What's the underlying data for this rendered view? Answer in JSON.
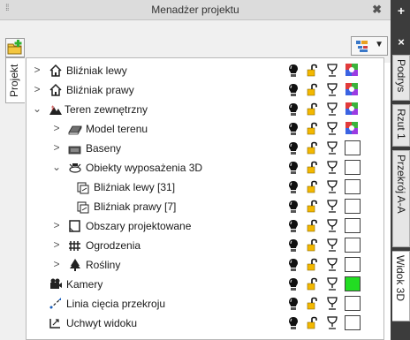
{
  "panel": {
    "title": "Menadżer projektu",
    "grip_symbol": "⁞⁞",
    "close_symbol": "✖"
  },
  "toolbar": {
    "add_icon": "add-folder-icon",
    "view_icon": "view-options-icon",
    "dropdown_symbol": "▼"
  },
  "left_tab": {
    "label": "Projekt"
  },
  "right_dock": {
    "plus_symbol": "+",
    "close_symbol": "×",
    "tabs": [
      {
        "label": "Podrys"
      },
      {
        "label": "Rzut 1"
      },
      {
        "label": "Przekrój A-A"
      },
      {
        "label": "Widok 3D"
      }
    ]
  },
  "tree": {
    "rows": [
      {
        "label": "Bliźniak lewy",
        "expander": ">",
        "icon": "house-icon",
        "visible": "bulb-icon",
        "lock": "unlock-icon",
        "render": "chalice-icon",
        "color_kind": "palette",
        "color_value": ""
      },
      {
        "label": "Bliźniak prawy",
        "expander": ">",
        "icon": "house-icon",
        "visible": "bulb-icon",
        "lock": "unlock-icon",
        "render": "chalice-icon",
        "color_kind": "palette",
        "color_value": ""
      },
      {
        "label": "Teren zewnętrzny",
        "expander": "⌄",
        "icon": "terrain-icon",
        "visible": "bulb-icon",
        "lock": "unlock-icon",
        "render": "chalice-icon",
        "color_kind": "palette",
        "color_value": ""
      },
      {
        "label": "Model terenu",
        "expander": ">",
        "icon": "terrain-model-icon",
        "visible": "bulb-icon",
        "lock": "unlock-icon",
        "render": "chalice-icon",
        "color_kind": "palette",
        "color_value": ""
      },
      {
        "label": "Baseny",
        "expander": ">",
        "icon": "pool-icon",
        "visible": "bulb-icon",
        "lock": "unlock-icon",
        "render": "chalice-icon",
        "color_kind": "box",
        "color_value": "#ffffff"
      },
      {
        "label": "Obiekty wyposażenia 3D",
        "expander": "⌄",
        "icon": "equipment-icon",
        "visible": "bulb-icon",
        "lock": "unlock-icon",
        "render": "chalice-icon",
        "color_kind": "box",
        "color_value": "#ffffff"
      },
      {
        "label": "Bliźniak lewy [31]",
        "expander": "",
        "icon": "object-copy-icon",
        "visible": "bulb-icon",
        "lock": "unlock-icon",
        "render": "chalice-icon",
        "color_kind": "box",
        "color_value": "#ffffff"
      },
      {
        "label": "Bliźniak prawy [7]",
        "expander": "",
        "icon": "object-copy-icon",
        "visible": "bulb-icon",
        "lock": "unlock-icon",
        "render": "chalice-icon",
        "color_kind": "box",
        "color_value": "#ffffff"
      },
      {
        "label": "Obszary projektowane",
        "expander": ">",
        "icon": "area-icon",
        "visible": "bulb-icon",
        "lock": "unlock-icon",
        "render": "chalice-icon",
        "color_kind": "box",
        "color_value": "#ffffff"
      },
      {
        "label": "Ogrodzenia",
        "expander": ">",
        "icon": "fence-icon",
        "visible": "bulb-icon",
        "lock": "unlock-icon",
        "render": "chalice-icon",
        "color_kind": "box",
        "color_value": "#ffffff"
      },
      {
        "label": "Rośliny",
        "expander": ">",
        "icon": "tree-icon",
        "visible": "bulb-icon",
        "lock": "unlock-icon",
        "render": "chalice-icon",
        "color_kind": "box",
        "color_value": "#ffffff"
      },
      {
        "label": "Kamery",
        "expander": "",
        "icon": "camera-icon",
        "visible": "bulb-icon",
        "lock": "unlock-icon",
        "render": "chalice-icon",
        "color_kind": "box",
        "color_value": "#22dd22"
      },
      {
        "label": "Linia cięcia przekroju",
        "expander": "",
        "icon": "section-line-icon",
        "visible": "bulb-icon",
        "lock": "unlock-icon",
        "render": "chalice-icon",
        "color_kind": "box",
        "color_value": "#ffffff"
      },
      {
        "label": "Uchwyt widoku",
        "expander": "",
        "icon": "view-handle-icon",
        "visible": "bulb-icon",
        "lock": "unlock-icon",
        "render": "chalice-icon",
        "color_kind": "box",
        "color_value": "#ffffff"
      }
    ]
  }
}
